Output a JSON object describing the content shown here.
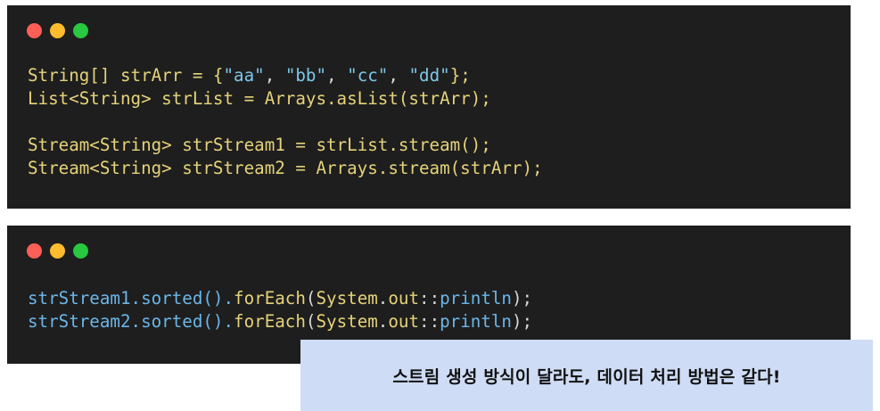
{
  "window_dots": {
    "colors": [
      "#ff5f57",
      "#febc2e",
      "#28c840"
    ],
    "icons": [
      "close-dot-icon",
      "minimize-dot-icon",
      "maximize-dot-icon"
    ]
  },
  "colors": {
    "code_bg": "#1e1e1e",
    "note_bg": "#cfdcf5"
  },
  "code_block_1": {
    "lines": [
      [
        {
          "t": "String[] strArr = {",
          "c": "plain"
        },
        {
          "t": "\"aa\"",
          "c": "str"
        },
        {
          "t": ", ",
          "c": "punc"
        },
        {
          "t": "\"bb\"",
          "c": "str"
        },
        {
          "t": ", ",
          "c": "punc"
        },
        {
          "t": "\"cc\"",
          "c": "str"
        },
        {
          "t": ", ",
          "c": "punc"
        },
        {
          "t": "\"dd\"",
          "c": "str"
        },
        {
          "t": "};",
          "c": "plain"
        }
      ],
      [
        {
          "t": "List<String> strList = Arrays.asList(strArr);",
          "c": "plain"
        }
      ],
      [],
      [
        {
          "t": "Stream<String> strStream1 = strList.stream();",
          "c": "plain"
        }
      ],
      [
        {
          "t": "Stream<String> strStream2 = Arrays.stream(strArr);",
          "c": "plain"
        }
      ]
    ]
  },
  "code_block_2": {
    "lines": [
      [
        {
          "t": "strStream1.sorted().",
          "c": "blue"
        },
        {
          "t": "forEach",
          "c": "method"
        },
        {
          "t": "(",
          "c": "punc"
        },
        {
          "t": "System",
          "c": "method"
        },
        {
          "t": ".",
          "c": "punc"
        },
        {
          "t": "out",
          "c": "method"
        },
        {
          "t": "::",
          "c": "punc"
        },
        {
          "t": "println",
          "c": "blue"
        },
        {
          "t": ");",
          "c": "punc"
        }
      ],
      [
        {
          "t": "strStream2.sorted().",
          "c": "blue"
        },
        {
          "t": "forEach",
          "c": "method"
        },
        {
          "t": "(",
          "c": "punc"
        },
        {
          "t": "System",
          "c": "method"
        },
        {
          "t": ".",
          "c": "punc"
        },
        {
          "t": "out",
          "c": "method"
        },
        {
          "t": "::",
          "c": "punc"
        },
        {
          "t": "println",
          "c": "blue"
        },
        {
          "t": ");",
          "c": "punc"
        }
      ]
    ]
  },
  "note": {
    "text": "스트림 생성 방식이 달라도, 데이터 처리 방법은 같다!"
  }
}
